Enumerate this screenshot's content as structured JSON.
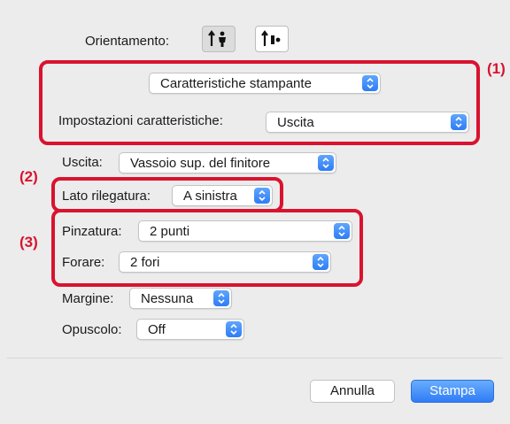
{
  "orientation": {
    "label": "Orientamento:"
  },
  "panel_menu": {
    "selected": "Caratteristiche stampante"
  },
  "feature_sets": {
    "label": "Impostazioni caratteristiche:",
    "selected": "Uscita"
  },
  "output": {
    "label": "Uscita:",
    "selected": "Vassoio sup. del finitore"
  },
  "binding_edge": {
    "label": "Lato rilegatura:",
    "selected": "A sinistra"
  },
  "staple": {
    "label": "Pinzatura:",
    "selected": "2 punti"
  },
  "punch": {
    "label": "Forare:",
    "selected": "2 fori"
  },
  "margin": {
    "label": "Margine:",
    "selected": "Nessuna"
  },
  "booklet": {
    "label": "Opuscolo:",
    "selected": "Off"
  },
  "buttons": {
    "cancel": "Annulla",
    "print": "Stampa"
  },
  "callouts": {
    "c1": "(1)",
    "c2": "(2)",
    "c3": "(3)"
  },
  "colors": {
    "highlight": "#d9132f",
    "accent": "#2f7cf6",
    "dialog_bg": "#ececec"
  },
  "icons": [
    "portrait-orientation-icon",
    "landscape-orientation-icon",
    "popup-arrows-icon"
  ]
}
